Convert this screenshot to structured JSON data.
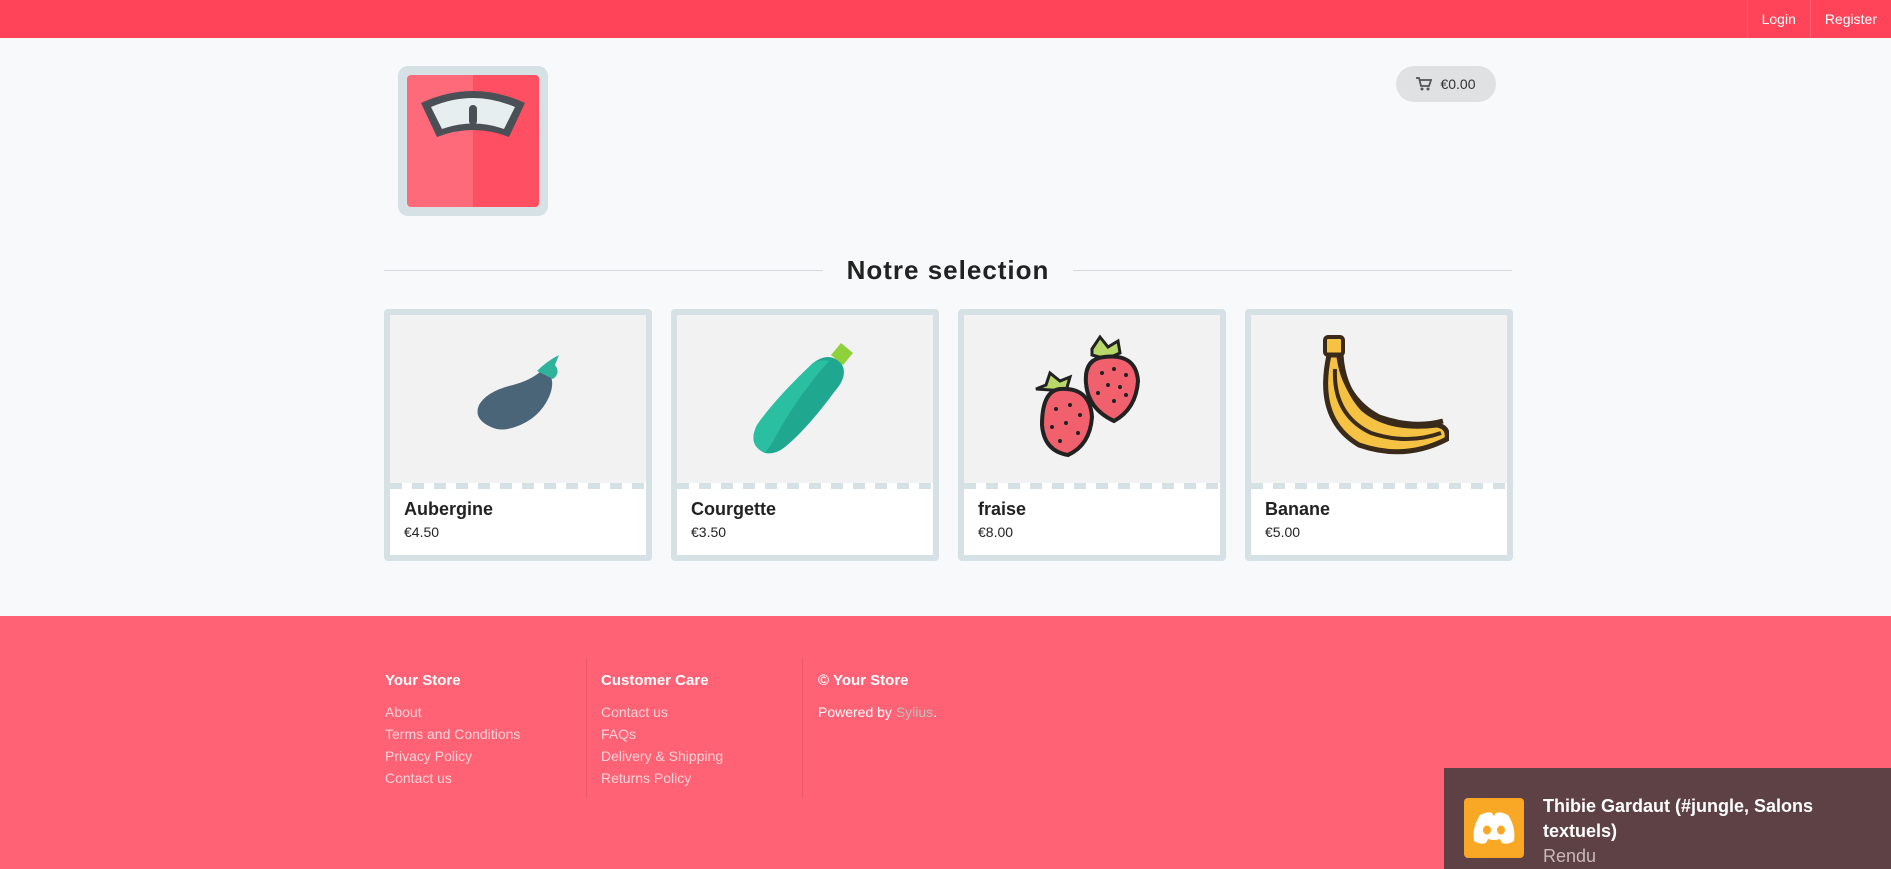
{
  "topbar": {
    "login": "Login",
    "register": "Register"
  },
  "header": {
    "logo_icon": "scale-icon",
    "cart_total": "€0.00",
    "cart_icon": "cart-icon"
  },
  "section": {
    "title": "Notre selection"
  },
  "products": [
    {
      "name": "Aubergine",
      "price": "€4.50",
      "icon": "eggplant-icon"
    },
    {
      "name": "Courgette",
      "price": "€3.50",
      "icon": "zucchini-icon"
    },
    {
      "name": "fraise",
      "price": "€8.00",
      "icon": "strawberry-icon"
    },
    {
      "name": "Banane",
      "price": "€5.00",
      "icon": "banana-icon"
    }
  ],
  "footer": {
    "store": {
      "title": "Your Store",
      "links": [
        "About",
        "Terms and Conditions",
        "Privacy Policy",
        "Contact us"
      ]
    },
    "care": {
      "title": "Customer Care",
      "links": [
        "Contact us",
        "FAQs",
        "Delivery & Shipping",
        "Returns Policy"
      ]
    },
    "copy": {
      "title": "© Your Store",
      "powered_prefix": "Powered by ",
      "powered_link": "Sylius",
      "powered_suffix": "."
    }
  },
  "toast": {
    "title": "Thibie Gardaut (#jungle, Salons textuels)",
    "subtitle": "Rendu",
    "icon": "discord-icon"
  },
  "colors": {
    "brand": "#ff4459",
    "footer": "#ff6275",
    "card_border": "#d6e1e6",
    "toast_bg": "#5e4145",
    "toast_icon": "#f9a825"
  }
}
